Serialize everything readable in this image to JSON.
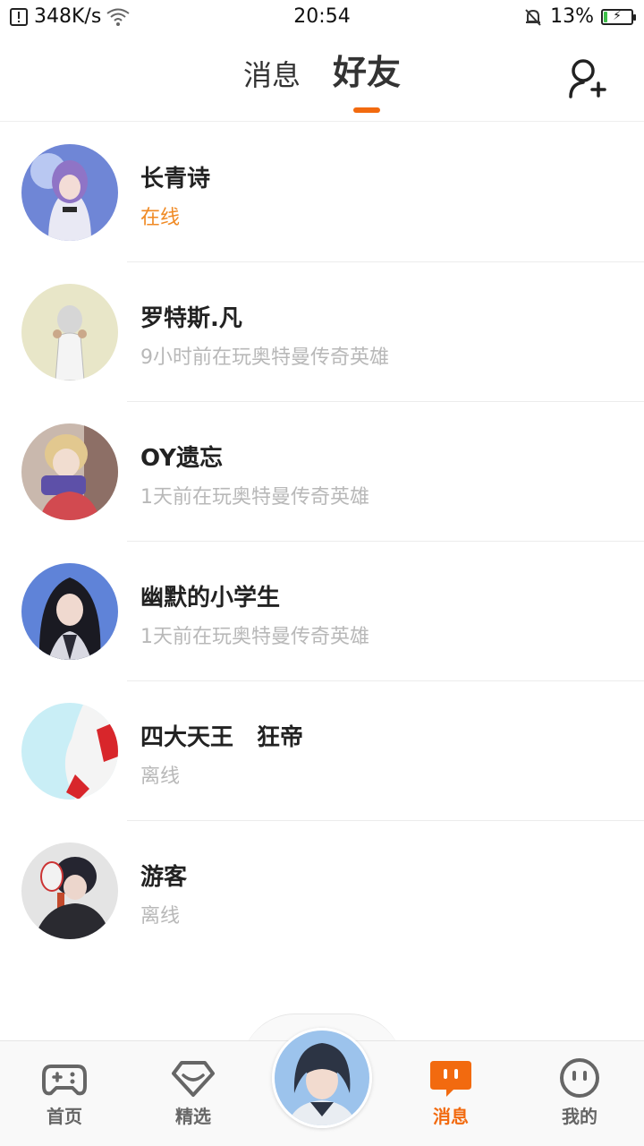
{
  "status_bar": {
    "speed": "348K/s",
    "time": "20:54",
    "battery": "13%",
    "battery_level": 0.13,
    "battery_color": "#3fbf4a"
  },
  "header": {
    "tabs": [
      {
        "label": "消息",
        "active": false
      },
      {
        "label": "好友",
        "active": true
      }
    ],
    "accent": "#f26a0f",
    "add_friend_icon": "add-friend-icon"
  },
  "friends": [
    {
      "name": "长青诗",
      "status": "在线",
      "online": true
    },
    {
      "name": "罗特斯.凡",
      "status": "9小时前在玩奥特曼传奇英雄",
      "online": false
    },
    {
      "name": "OY遗忘",
      "status": "1天前在玩奥特曼传奇英雄",
      "online": false
    },
    {
      "name": "幽默的小学生",
      "status": "1天前在玩奥特曼传奇英雄",
      "online": false
    },
    {
      "name": "四大天王　狂帝",
      "status": "离线",
      "online": false
    },
    {
      "name": "游客",
      "status": "离线",
      "online": false
    }
  ],
  "bottom_nav": {
    "items": [
      {
        "label": "首页",
        "icon": "gamepad-icon",
        "active": false
      },
      {
        "label": "精选",
        "icon": "heart-diamond-icon",
        "active": false
      },
      {
        "label": "消息",
        "icon": "chat-icon",
        "active": true
      },
      {
        "label": "我的",
        "icon": "smiley-icon",
        "active": false
      }
    ],
    "active_color": "#f26a0f",
    "inactive_color": "#666666"
  }
}
